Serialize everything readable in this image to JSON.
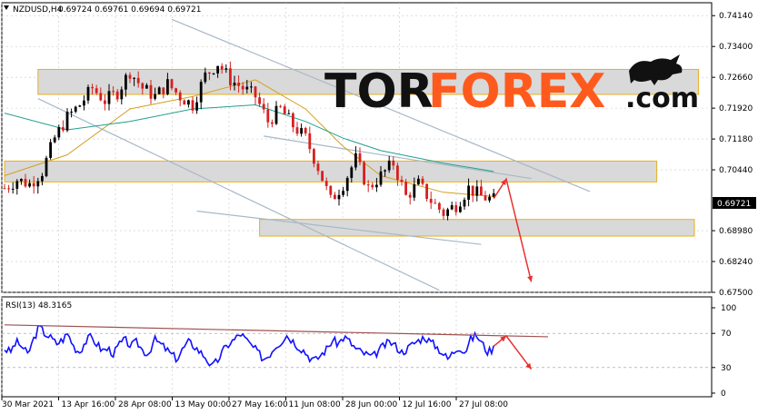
{
  "header": {
    "symbol": "NZDUSD,H4",
    "ohlc": "0.69724 0.69761 0.69694 0.69721"
  },
  "logo": {
    "part1": "TOR",
    "part2": "FOREX",
    "part3": ".com"
  },
  "colors": {
    "background": "#ffffff",
    "grid": "#c8c8c8",
    "bull_candle": "#000000",
    "bear_candle": "#d62020",
    "ma_fast": "#d4a020",
    "ma_slow": "#20a090",
    "channel_line": "#a8b8c8",
    "zone_fill": "#d9d9d9",
    "zone_border": "#e8b020",
    "forecast_arrow": "#e83030",
    "rsi_line": "#1010ff",
    "rsi_trend": "#a05050",
    "logo_dark": "#111111",
    "logo_accent": "#ff5a1e"
  },
  "chart_data": [
    {
      "type": "candlestick",
      "title": "NZDUSD,H4",
      "ylim": [
        0.675,
        0.7445
      ],
      "y_ticks": [
        "0.74140",
        "0.73400",
        "0.72660",
        "0.71920",
        "0.71180",
        "0.70440",
        "0.69721",
        "0.68980",
        "0.68240",
        "0.67500"
      ],
      "current_price": "0.69721",
      "x_ticks": [
        "30 Mar 2021",
        "13 Apr 16:00",
        "28 Apr 08:00",
        "13 May 00:00",
        "27 May 16:00",
        "11 Jun 08:00",
        "28 Jun 00:00",
        "12 Jul 16:00",
        "27 Jul 08:00"
      ],
      "close_path": [
        [
          0,
          0.7
        ],
        [
          3,
          0.702
        ],
        [
          6,
          0.701
        ],
        [
          9,
          0.704
        ],
        [
          12,
          0.712
        ],
        [
          15,
          0.717
        ],
        [
          18,
          0.72
        ],
        [
          21,
          0.724
        ],
        [
          24,
          0.721
        ],
        [
          27,
          0.723
        ],
        [
          30,
          0.728
        ],
        [
          33,
          0.724
        ],
        [
          36,
          0.722
        ],
        [
          39,
          0.725
        ],
        [
          42,
          0.722
        ],
        [
          45,
          0.72
        ],
        [
          48,
          0.727
        ],
        [
          51,
          0.73
        ],
        [
          54,
          0.726
        ],
        [
          57,
          0.724
        ],
        [
          60,
          0.722
        ],
        [
          63,
          0.716
        ],
        [
          66,
          0.719
        ],
        [
          69,
          0.715
        ],
        [
          72,
          0.712
        ],
        [
          75,
          0.705
        ],
        [
          78,
          0.697
        ],
        [
          81,
          0.701
        ],
        [
          84,
          0.707
        ],
        [
          87,
          0.7
        ],
        [
          90,
          0.703
        ],
        [
          93,
          0.706
        ],
        [
          96,
          0.698
        ],
        [
          99,
          0.701
        ],
        [
          102,
          0.697
        ],
        [
          105,
          0.694
        ],
        [
          108,
          0.696
        ],
        [
          111,
          0.7
        ],
        [
          114,
          0.698
        ],
        [
          117,
          0.6972
        ]
      ],
      "moving_averages": [
        {
          "name": "MA fast",
          "color_key": "ma_fast",
          "points": [
            [
              0,
              0.703
            ],
            [
              15,
              0.708
            ],
            [
              30,
              0.719
            ],
            [
              45,
              0.722
            ],
            [
              60,
              0.726
            ],
            [
              72,
              0.719
            ],
            [
              81,
              0.71
            ],
            [
              90,
              0.703
            ],
            [
              105,
              0.699
            ],
            [
              117,
              0.698
            ]
          ]
        },
        {
          "name": "MA slow",
          "color_key": "ma_slow",
          "points": [
            [
              0,
              0.718
            ],
            [
              15,
              0.714
            ],
            [
              30,
              0.716
            ],
            [
              45,
              0.719
            ],
            [
              60,
              0.72
            ],
            [
              72,
              0.716
            ],
            [
              81,
              0.712
            ],
            [
              90,
              0.709
            ],
            [
              105,
              0.706
            ],
            [
              117,
              0.704
            ]
          ]
        }
      ],
      "trend_lines": [
        {
          "from": [
            40,
            0.7405
          ],
          "to": [
            140,
            0.6992
          ]
        },
        {
          "from": [
            8,
            0.7215
          ],
          "to": [
            104,
            0.6755
          ]
        },
        {
          "from": [
            62,
            0.7125
          ],
          "to": [
            126,
            0.7023
          ]
        },
        {
          "from": [
            46,
            0.6945
          ],
          "to": [
            114,
            0.6865
          ]
        }
      ],
      "zones": [
        {
          "from": [
            8,
            0.7285
          ],
          "to": [
            166,
            0.7225
          ]
        },
        {
          "from": [
            0,
            0.7065
          ],
          "to": [
            156,
            0.7015
          ]
        },
        {
          "from": [
            61,
            0.6925
          ],
          "to": [
            165,
            0.6885
          ]
        }
      ],
      "forecast": [
        [
          117,
          0.6975
        ],
        [
          120,
          0.7022
        ],
        [
          126,
          0.6775
        ]
      ]
    },
    {
      "type": "line",
      "title": "RSI(13) 48.3165",
      "ylim": [
        0,
        100
      ],
      "y_ticks": [
        "100",
        "70",
        "30",
        "0"
      ],
      "levels": [
        70,
        30
      ],
      "series": [
        {
          "name": "RSI(13)",
          "values": [
            52,
            48,
            60,
            55,
            45,
            62,
            78,
            70,
            65,
            58,
            62,
            70,
            55,
            48,
            60,
            66,
            58,
            50,
            52,
            46,
            58,
            62,
            55,
            60,
            50,
            46,
            63,
            58,
            52,
            45,
            40,
            52,
            60,
            55,
            48,
            42,
            30,
            38,
            50,
            58,
            63,
            70,
            62,
            55,
            48,
            40,
            45,
            55,
            60,
            68,
            62,
            55,
            50,
            42,
            38,
            45,
            52,
            62,
            58,
            66,
            60,
            52,
            48,
            45,
            42,
            50,
            56,
            60,
            55,
            48,
            52,
            58,
            62,
            66,
            60,
            55,
            48,
            40,
            48,
            55,
            48,
            63,
            68,
            58,
            48,
            53
          ]
        }
      ],
      "rsi_trend": {
        "from": [
          0,
          80
        ],
        "to": [
          130,
          66
        ]
      },
      "forecast": [
        [
          117,
          55
        ],
        [
          120,
          67
        ],
        [
          126,
          28
        ]
      ]
    }
  ]
}
